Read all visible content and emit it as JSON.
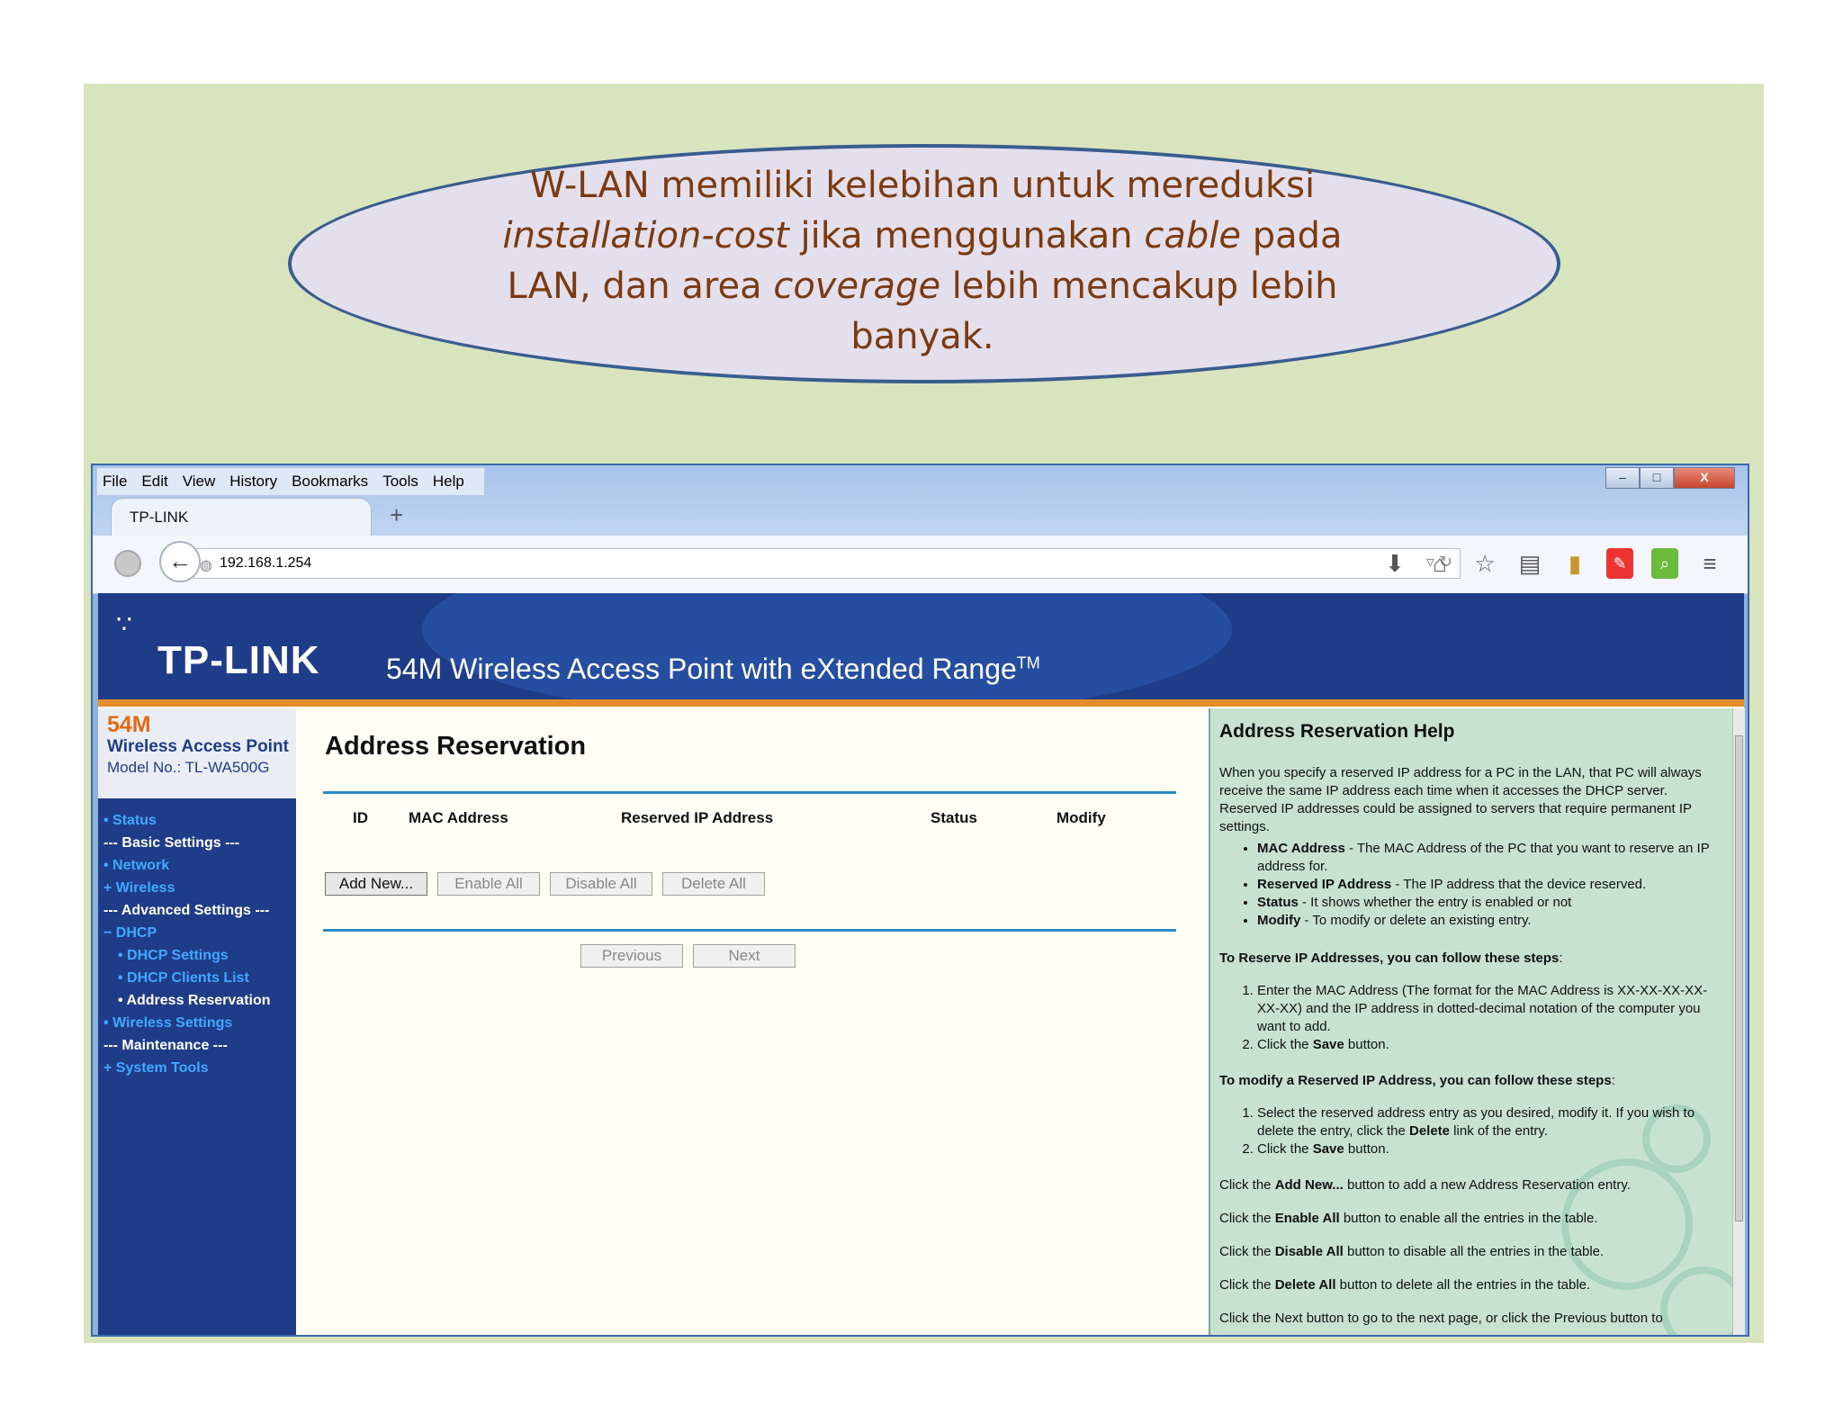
{
  "slide": {
    "line1": "W-LAN memiliki kelebihan untuk mereduksi",
    "line2_italic1": "installation-cost",
    "line2_mid": " jika menggunakan ",
    "line2_italic2": "cable",
    "line2_end": " pada",
    "line3_start": "LAN, dan area ",
    "line3_italic": "coverage",
    "line3_end": " lebih mencakup lebih",
    "line4": "banyak."
  },
  "browser": {
    "menu": [
      "File",
      "Edit",
      "View",
      "History",
      "Bookmarks",
      "Tools",
      "Help"
    ],
    "window_controls": [
      "–",
      "□",
      "X"
    ],
    "tab_title": "TP-LINK",
    "new_tab": "+",
    "url": "192.168.1.254",
    "toolbar_icons": [
      "download-icon",
      "home-icon",
      "star-icon",
      "reader-icon",
      "bookmark-icon",
      "acrobat-icon",
      "addon-icon",
      "menu-icon"
    ]
  },
  "router": {
    "logo": "TP-LINK",
    "product": "54M Wireless Access Point with eXtended Range",
    "product_tm": "TM",
    "model_54": "54M",
    "model_name": "Wireless Access Point",
    "model_no": "Model No.: TL-WA500G",
    "menu": {
      "status": "Status",
      "basic": "--- Basic Settings ---",
      "network": "Network",
      "wireless": "Wireless",
      "advanced": "--- Advanced Settings ---",
      "dhcp": "DHCP",
      "dhcp_settings": "DHCP Settings",
      "dhcp_clients": "DHCP Clients List",
      "address_reservation": "Address Reservation",
      "wireless_settings": "Wireless Settings",
      "maintenance": "--- Maintenance ---",
      "system_tools": "System Tools"
    },
    "content": {
      "title": "Address Reservation",
      "columns": [
        "ID",
        "MAC Address",
        "Reserved IP Address",
        "Status",
        "Modify"
      ],
      "buttons": {
        "add_new": "Add New...",
        "enable_all": "Enable All",
        "disable_all": "Disable All",
        "delete_all": "Delete All",
        "previous": "Previous",
        "next": "Next"
      }
    },
    "help": {
      "title": "Address Reservation Help",
      "intro": "When you specify a reserved IP address for a PC in the LAN, that PC will always receive the same IP address each time when it accesses the DHCP server. Reserved IP addresses could be assigned to servers that require permanent IP settings.",
      "bullets": [
        {
          "term": "MAC Address",
          "text": " - The MAC Address of the PC that you want to reserve an IP address for."
        },
        {
          "term": "Reserved IP Address",
          "text": " - The IP address that the device reserved."
        },
        {
          "term": "Status",
          "text": " - It shows whether the entry is enabled or not"
        },
        {
          "term": "Modify",
          "text": " - To modify or delete an existing entry."
        }
      ],
      "reserve_heading": "To Reserve IP Addresses, you can follow these steps",
      "reserve_step1": "Enter the MAC Address (The format for the MAC Address is XX-XX-XX-XX-XX-XX) and the IP address in dotted-decimal notation of the computer you want to add.",
      "reserve_step2_pre": "Click the ",
      "save": "Save",
      "step2_post": " button.",
      "modify_heading": "To modify a Reserved IP Address, you can follow these steps",
      "modify_step1_pre": "Select the reserved address entry as you desired, modify it. If you wish to delete the entry, click the ",
      "delete": "Delete",
      "modify_step1_post": " link of the entry.",
      "click_the": "Click the ",
      "add_new_term": "Add New...",
      "add_new_text": " button to add a new Address Reservation entry.",
      "enable_term": "Enable All",
      "enable_text": " button to enable all the entries in the table.",
      "disable_term": "Disable All",
      "disable_text": " button to disable all the entries in the table.",
      "delete_term": "Delete All",
      "delete_text": " button to delete all the entries in the table.",
      "cutoff": "Click the Next button to go to the next page, or click the Previous button to"
    }
  }
}
